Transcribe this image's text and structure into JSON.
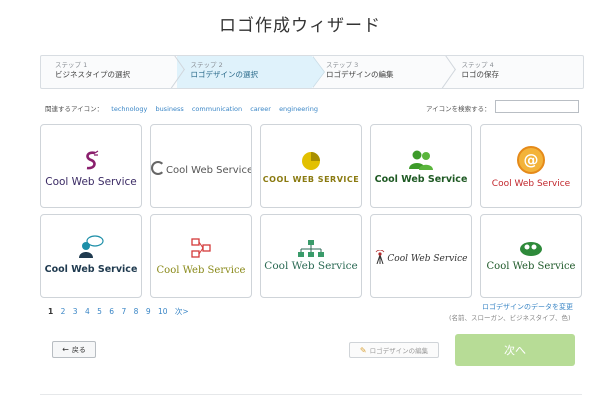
{
  "page": {
    "title": "ロゴ作成ウィザード"
  },
  "steps": [
    {
      "num": "ステップ 1",
      "label": "ビジネスタイプの選択"
    },
    {
      "num": "ステップ 2",
      "label": "ロゴデザインの選択"
    },
    {
      "num": "ステップ 3",
      "label": "ロゴデザインの編集"
    },
    {
      "num": "ステップ 4",
      "label": "ロゴの保存"
    }
  ],
  "related": {
    "label": "関連するアイコン：",
    "tags": [
      "technology",
      "business",
      "communication",
      "career",
      "engineering"
    ]
  },
  "search": {
    "label": "アイコンを検索する：",
    "value": ""
  },
  "logos": [
    {
      "text": "Cool Web Service",
      "icon": "dragon-s-icon",
      "color": "#3a2a64",
      "iconColor": "#8a1f6d"
    },
    {
      "text": "Cool Web Service",
      "icon": "c-swirl-icon",
      "color": "#555555",
      "iconColor": "#666666"
    },
    {
      "text": "COOL WEB SERVICE",
      "icon": "pie-icon",
      "color": "#8a7a10",
      "iconColor": "#e2c000"
    },
    {
      "text": "Cool Web Service",
      "icon": "people-icon",
      "color": "#1f5a24",
      "iconColor": "#3d9b2a"
    },
    {
      "text": "Cool Web Service",
      "icon": "at-sign-icon",
      "color": "#c2272d",
      "iconColor": "#e58a1a"
    },
    {
      "text": "Cool Web Service",
      "icon": "chat-person-icon",
      "color": "#1f3a4f",
      "iconColor": "#1d8fa8"
    },
    {
      "text": "Cool Web Service",
      "icon": "network-icon",
      "color": "#8a8a1a",
      "iconColor": "#d43a3a"
    },
    {
      "text": "Cool Web Service",
      "icon": "hierarchy-icon",
      "color": "#2b6a54",
      "iconColor": "#3a9b6a"
    },
    {
      "text": "Cool Web Service",
      "icon": "antenna-icon",
      "color": "#333333",
      "iconColor": "#b0282a"
    },
    {
      "text": "Cool Web Service",
      "icon": "cloud-people-icon",
      "color": "#1f5a2a",
      "iconColor": "#2e8a3a"
    }
  ],
  "pagination": {
    "pages": [
      "1",
      "2",
      "3",
      "4",
      "5",
      "6",
      "7",
      "8",
      "9",
      "10"
    ],
    "next": "次>"
  },
  "edit_data": {
    "link": "ロゴデザインのデータを変更",
    "hint": "(名前、スローガン、ビジネスタイプ、色)"
  },
  "buttons": {
    "back": "戻る",
    "edit": "ロゴデザインの編集",
    "next": "次へ"
  },
  "colors": {
    "accent": "#3a86c6",
    "next_button": "#b7dc96",
    "active_step": "#dff2fb"
  }
}
